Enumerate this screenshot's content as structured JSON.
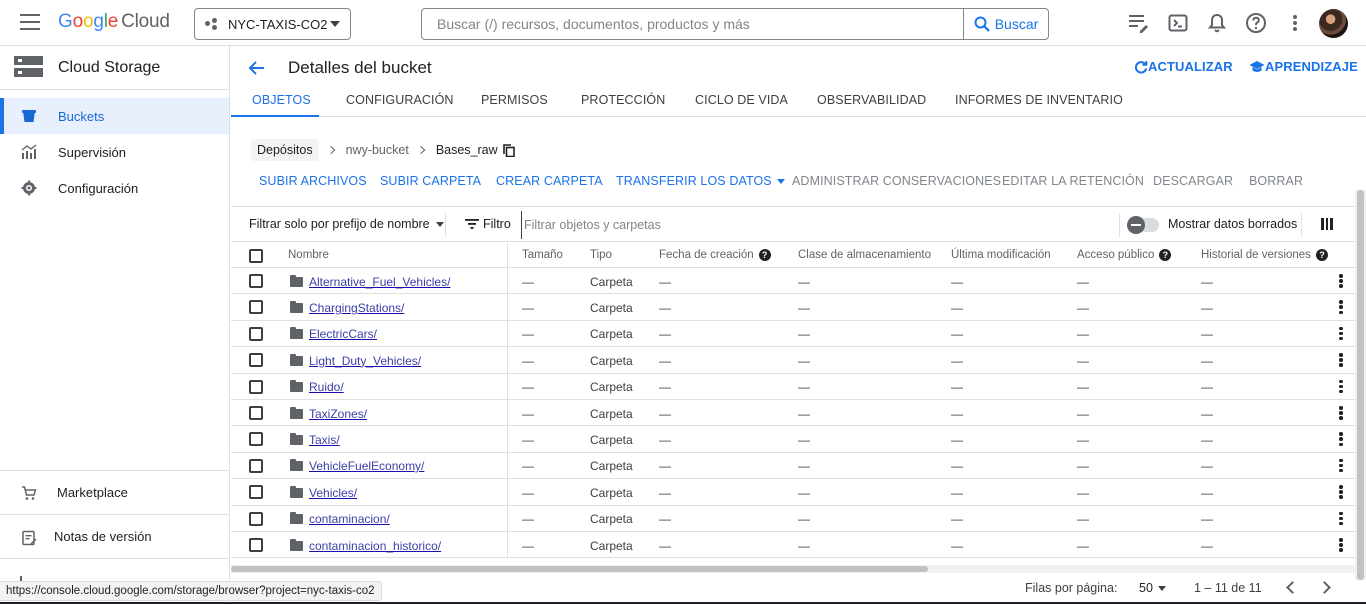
{
  "topbar": {
    "logo_letters": [
      "G",
      "o",
      "o",
      "g",
      "l",
      "e"
    ],
    "logo_suffix": "Cloud",
    "project_name": "NYC-TAXIS-CO2",
    "search_placeholder": "Buscar (/) recursos, documentos, productos y más",
    "search_button": "Buscar",
    "icons": [
      "notes-icon",
      "cloud-shell-icon",
      "notifications-icon",
      "help-icon",
      "more-vert-icon",
      "avatar"
    ]
  },
  "sidebar": {
    "product_title": "Cloud Storage",
    "items": [
      {
        "label": "Buckets",
        "icon": "bucket-icon",
        "active": true
      },
      {
        "label": "Supervisión",
        "icon": "monitoring-icon",
        "active": false
      },
      {
        "label": "Configuración",
        "icon": "settings-icon",
        "active": false
      }
    ],
    "bottom_items": [
      {
        "label": "Marketplace",
        "icon": "marketplace-icon"
      },
      {
        "label": "Notas de versión",
        "icon": "release-notes-icon"
      }
    ]
  },
  "header": {
    "title": "Detalles del bucket",
    "refresh_label": "ACTUALIZAR",
    "learn_label": "APRENDIZAJE"
  },
  "tabs": [
    "OBJETOS",
    "CONFIGURACIÓN",
    "PERMISOS",
    "PROTECCIÓN",
    "CICLO DE VIDA",
    "OBSERVABILIDAD",
    "INFORMES DE INVENTARIO"
  ],
  "breadcrumb": {
    "root": "Depósitos",
    "bucket": "nwy-bucket",
    "current": "Bases_raw"
  },
  "actions": {
    "upload_files": "SUBIR ARCHIVOS",
    "upload_folder": "SUBIR CARPETA",
    "create_folder": "CREAR CARPETA",
    "transfer": "TRANSFERIR LOS DATOS",
    "manage_holds": "ADMINISTRAR CONSERVACIONES",
    "edit_retention": "EDITAR LA RETENCIÓN",
    "download": "DESCARGAR",
    "delete": "BORRAR"
  },
  "filter": {
    "prefix_label": "Filtrar solo por prefijo de nombre",
    "filter_label": "Filtro",
    "filter_placeholder": "Filtrar objetos y carpetas",
    "show_deleted_label": "Mostrar datos borrados"
  },
  "table": {
    "columns": [
      "Nombre",
      "Tamaño",
      "Tipo",
      "Fecha de creación",
      "Clase de almacenamiento",
      "Última modificación",
      "Acceso público",
      "Historial de versiones"
    ],
    "empty_value": "—",
    "type_value": "Carpeta",
    "rows": [
      "Alternative_Fuel_Vehicles/",
      "ChargingStations/",
      "ElectricCars/",
      "Light_Duty_Vehicles/",
      "Ruido/",
      "TaxiZones/",
      "Taxis/",
      "VehicleFuelEconomy/",
      "Vehicles/",
      "contaminacion/",
      "contaminacion_historico/"
    ]
  },
  "pager": {
    "rows_per_page_label": "Filas por página:",
    "rows_per_page": "50",
    "range": "1 – 11 de 11"
  },
  "status_url": "https://console.cloud.google.com/storage/browser?project=nyc-taxis-co2",
  "colors": {
    "accent": "#1a73e8",
    "active_bg": "#e8f0fe",
    "divider": "#e0e0e0"
  }
}
